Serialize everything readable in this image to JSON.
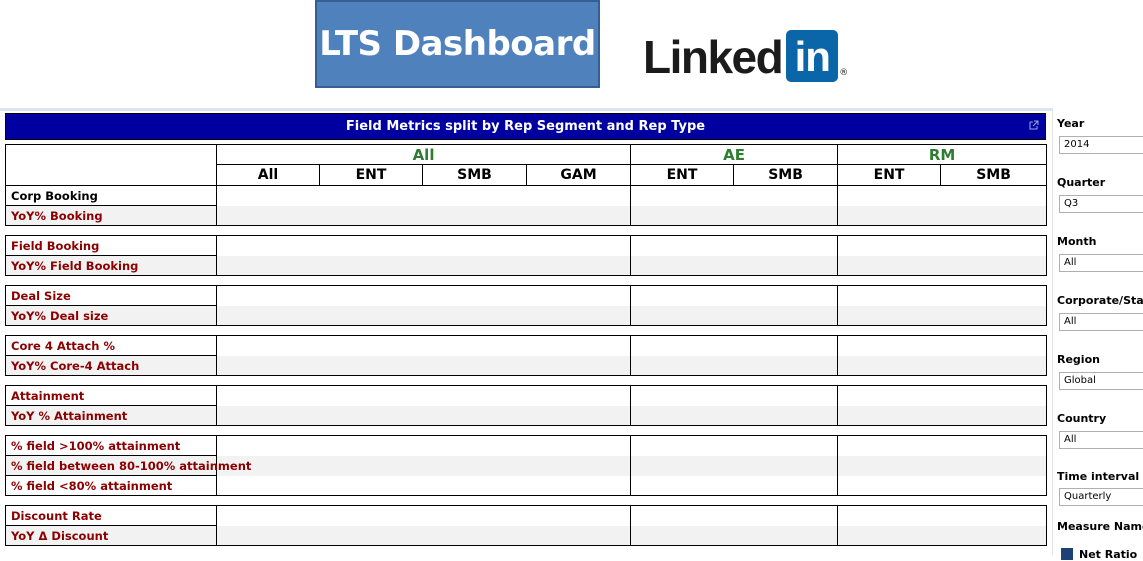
{
  "header": {
    "dashboard_title": "LTS Dashboard",
    "brand_word": "Linked",
    "brand_box": "in",
    "brand_reg": "®"
  },
  "report": {
    "title": "Field Metrics split by Rep Segment and Rep Type",
    "groups": [
      "All",
      "AE",
      "RM"
    ],
    "columns": [
      "All",
      "ENT",
      "SMB",
      "GAM",
      "ENT",
      "SMB",
      "ENT",
      "SMB"
    ],
    "sections": [
      {
        "rows": [
          {
            "label": "Corp Booking",
            "color": "black"
          },
          {
            "label": "YoY% Booking",
            "color": "red"
          }
        ]
      },
      {
        "rows": [
          {
            "label": "Field Booking",
            "color": "red"
          },
          {
            "label": "YoY% Field Booking",
            "color": "red"
          }
        ]
      },
      {
        "rows": [
          {
            "label": "Deal Size",
            "color": "red"
          },
          {
            "label": "YoY% Deal size",
            "color": "red"
          }
        ]
      },
      {
        "rows": [
          {
            "label": "Core 4 Attach %",
            "color": "red"
          },
          {
            "label": "YoY% Core-4 Attach",
            "color": "red"
          }
        ]
      },
      {
        "rows": [
          {
            "label": "Attainment",
            "color": "red"
          },
          {
            "label": "YoY % Attainment",
            "color": "red"
          }
        ]
      },
      {
        "rows": [
          {
            "label": "% field >100% attainment",
            "color": "red"
          },
          {
            "label": "% field between 80-100% attainment",
            "color": "red"
          },
          {
            "label": "% field <80% attainment",
            "color": "red"
          }
        ]
      },
      {
        "rows": [
          {
            "label": "Discount Rate",
            "color": "red"
          },
          {
            "label": "YoY Δ Discount",
            "color": "red"
          }
        ]
      }
    ]
  },
  "filters": {
    "year": {
      "label": "Year",
      "value": "2014"
    },
    "quarter": {
      "label": "Quarter",
      "value": "Q3"
    },
    "month": {
      "label": "Month",
      "value": "All"
    },
    "corporate_staff": {
      "label": "Corporate/Staf",
      "value": "All"
    },
    "region": {
      "label": "Region",
      "value": "Global"
    },
    "country": {
      "label": "Country",
      "value": "All"
    },
    "time_interval": {
      "label": "Time interval (for",
      "value": "Quarterly"
    },
    "measure_name": {
      "label": "Measure Name",
      "legend_item": "Net Ratio"
    }
  },
  "colors": {
    "title_bar": "#0000a0",
    "group_header": "#2e7d32",
    "row_label_red": "#8b0000",
    "lts_box": "#4f81bd",
    "linkedin_blue": "#0a66a8"
  }
}
